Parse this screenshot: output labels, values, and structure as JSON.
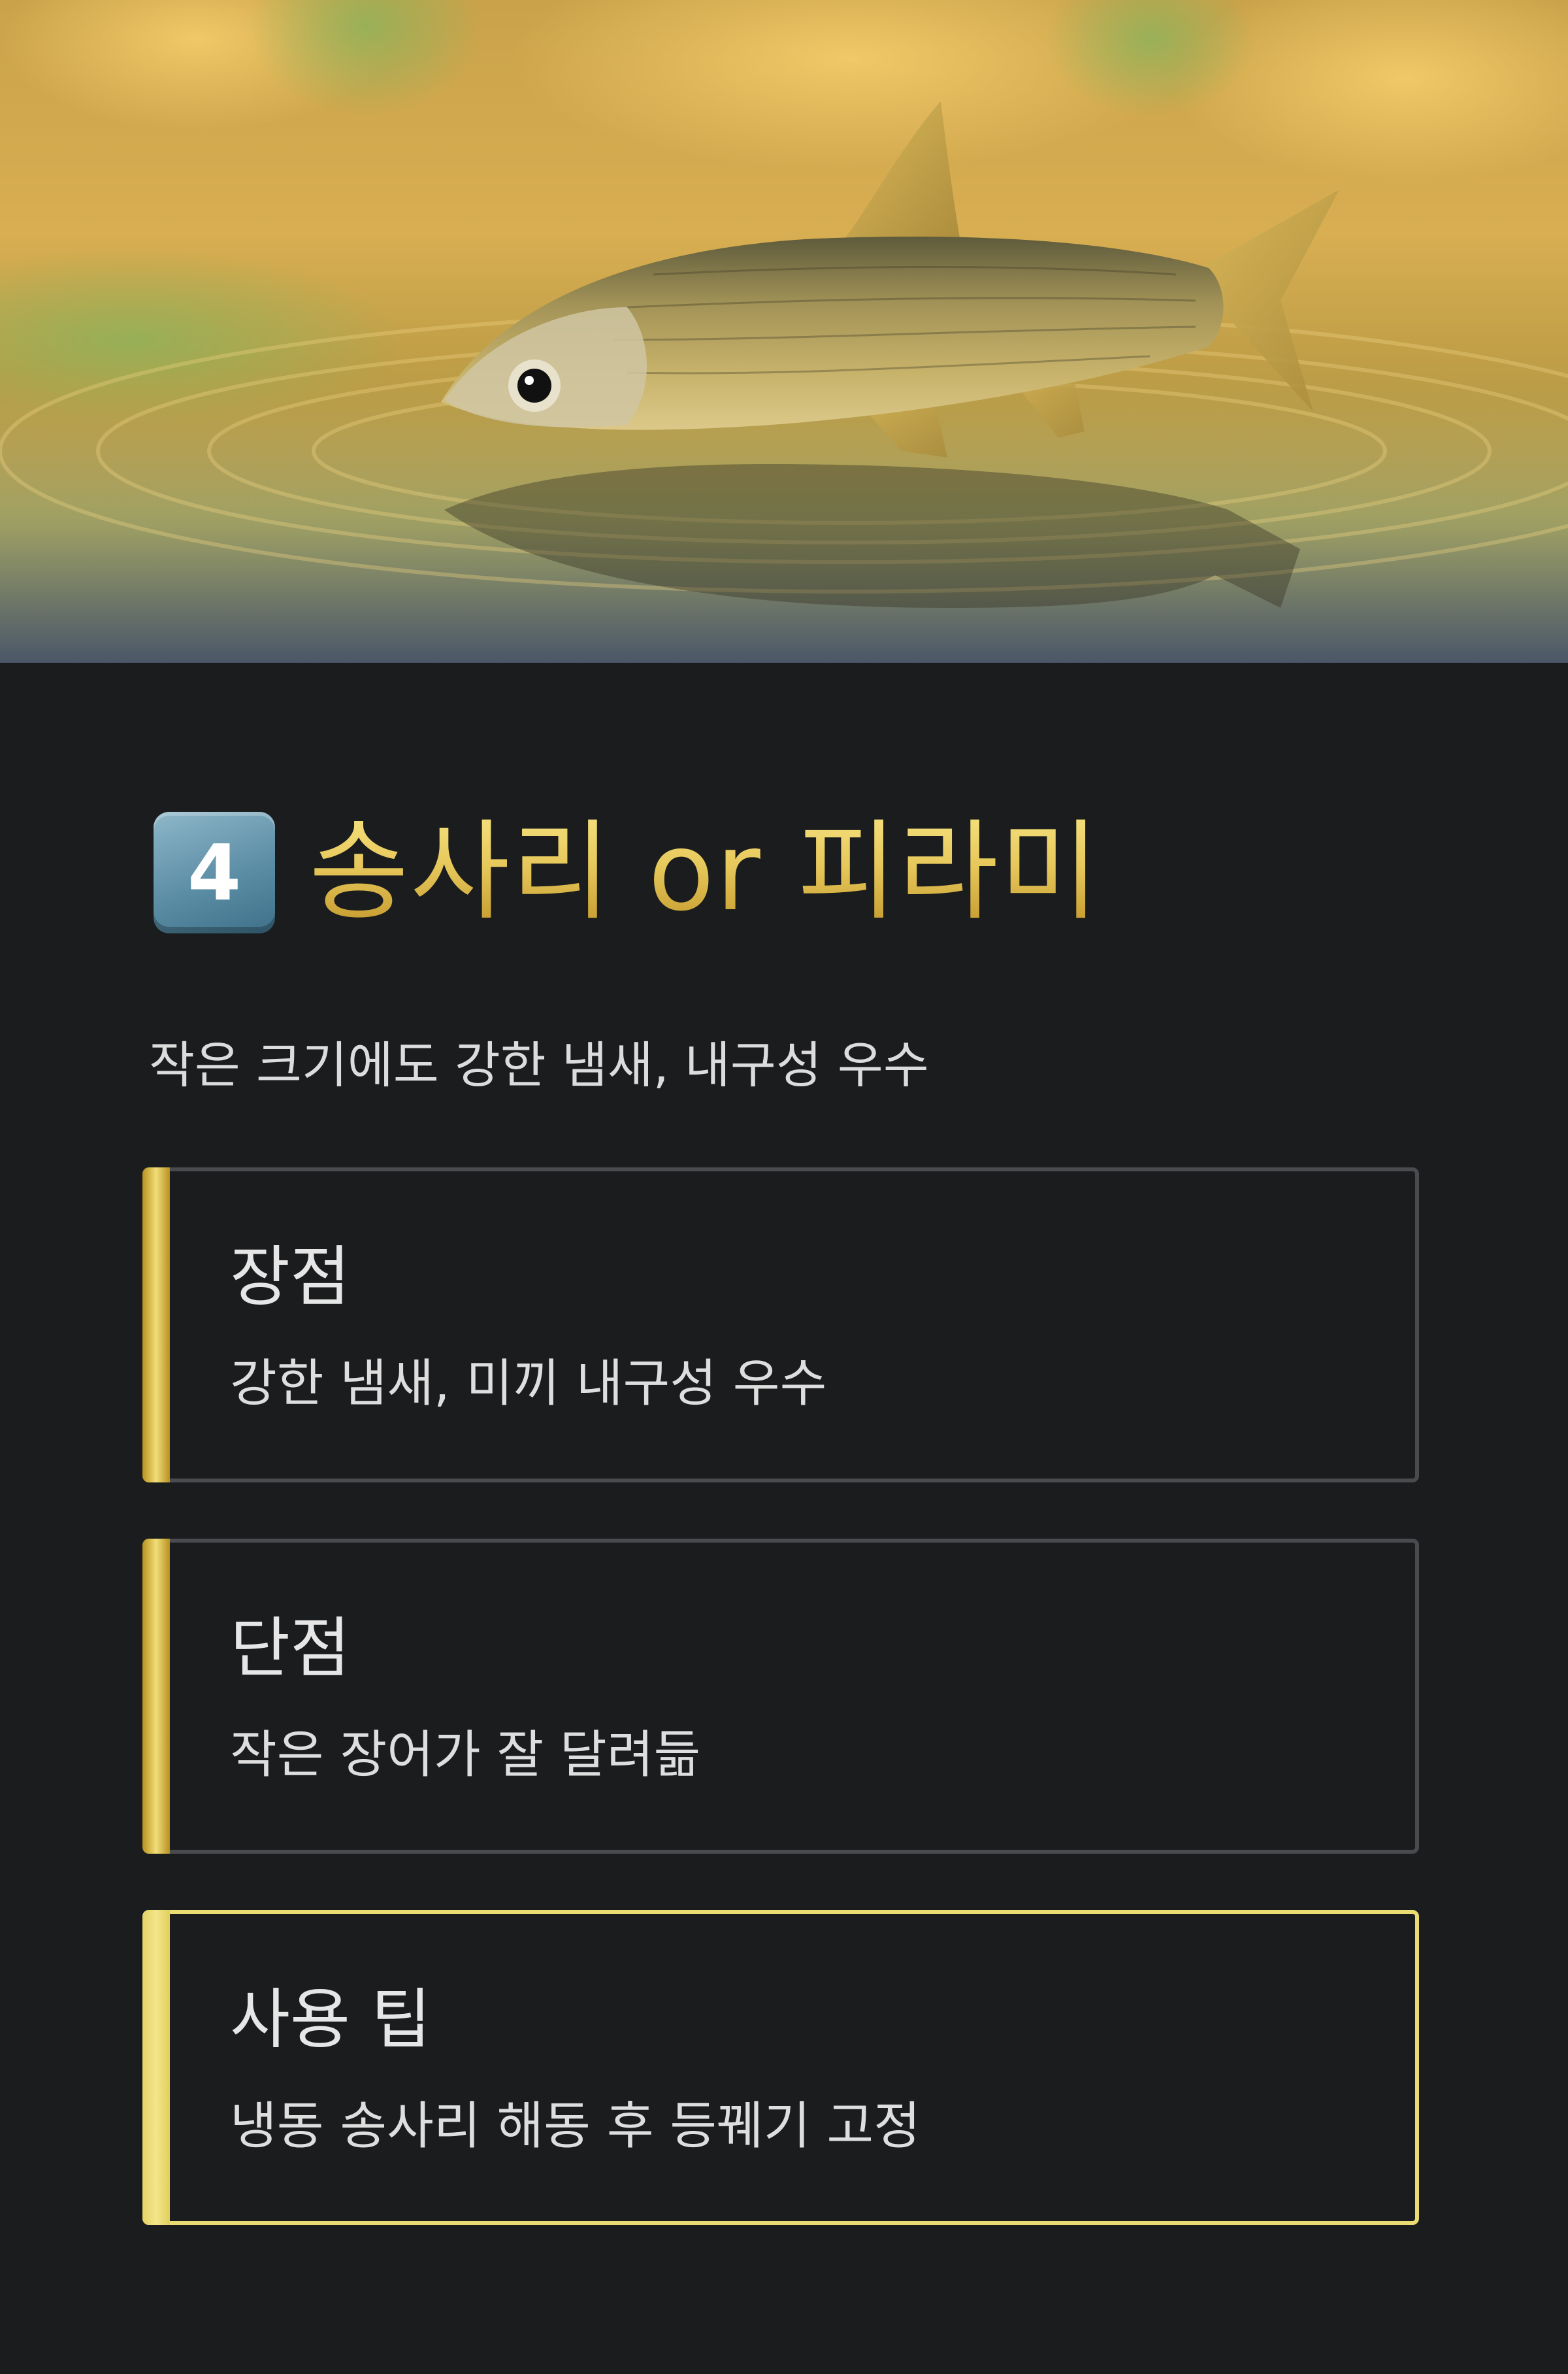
{
  "hero": {
    "image_subject": "fish-on-water",
    "accent_colors": [
      "#e9b655",
      "#7da35c",
      "#b79a38"
    ]
  },
  "title": {
    "keycap": "4",
    "text": "송사리 or 피라미",
    "color": "#e6c75a"
  },
  "subtitle": "작은 크기에도 강한 냄새, 내구성 우수",
  "cards": [
    {
      "title": "장점",
      "body": "강한 냄새, 미끼 내구성 우수"
    },
    {
      "title": "단점",
      "body": "작은 장어가 잘 달려듦"
    },
    {
      "title": "사용 팁",
      "body": "냉동 송사리 해동 후 등꿰기 고정"
    }
  ],
  "colors": {
    "background": "#1b1c1e",
    "card_border": "#4a4b4e",
    "highlight_border": "#eadb72",
    "gold": "#e6c75a"
  }
}
